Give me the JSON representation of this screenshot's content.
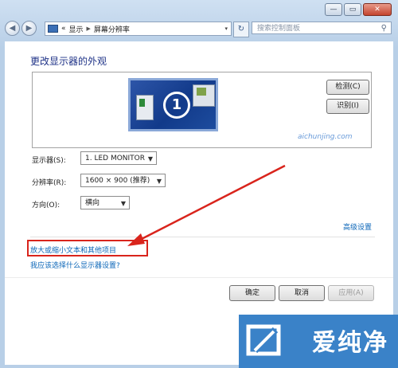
{
  "window": {
    "minimize_label": "—",
    "maximize_label": "▭",
    "close_label": "✕"
  },
  "nav": {
    "back_icon": "◀",
    "forward_icon": "▶",
    "chevron": "«",
    "crumb1": "显示",
    "crumb_sep": "▶",
    "crumb2": "屏幕分辨率",
    "dropdown_icon": "▾",
    "refresh_icon": "↻",
    "search_placeholder": "搜索控制面板",
    "search_icon": "⚲"
  },
  "content": {
    "heading": "更改显示器的外观",
    "monitor_number": "1",
    "detect_button": "检测(C)",
    "identify_button": "识别(I)",
    "display_label": "显示器(S):",
    "display_value": "1. LED MONITOR",
    "resolution_label": "分辨率(R):",
    "resolution_value": "1600 × 900 (推荐)",
    "orientation_label": "方向(O):",
    "orientation_value": "横向",
    "advanced_link": "高级设置",
    "enlarge_link": "放大或缩小文本和其他项目",
    "which_link": "我应该选择什么显示器设置?",
    "ok_button": "确定",
    "cancel_button": "取消",
    "apply_button": "应用(A)"
  },
  "watermark": {
    "url": "aichunjing.com",
    "brand": "爱纯净"
  },
  "colors": {
    "link": "#0b66b8",
    "highlight": "#d9241c",
    "brand": "#3a82c8"
  }
}
